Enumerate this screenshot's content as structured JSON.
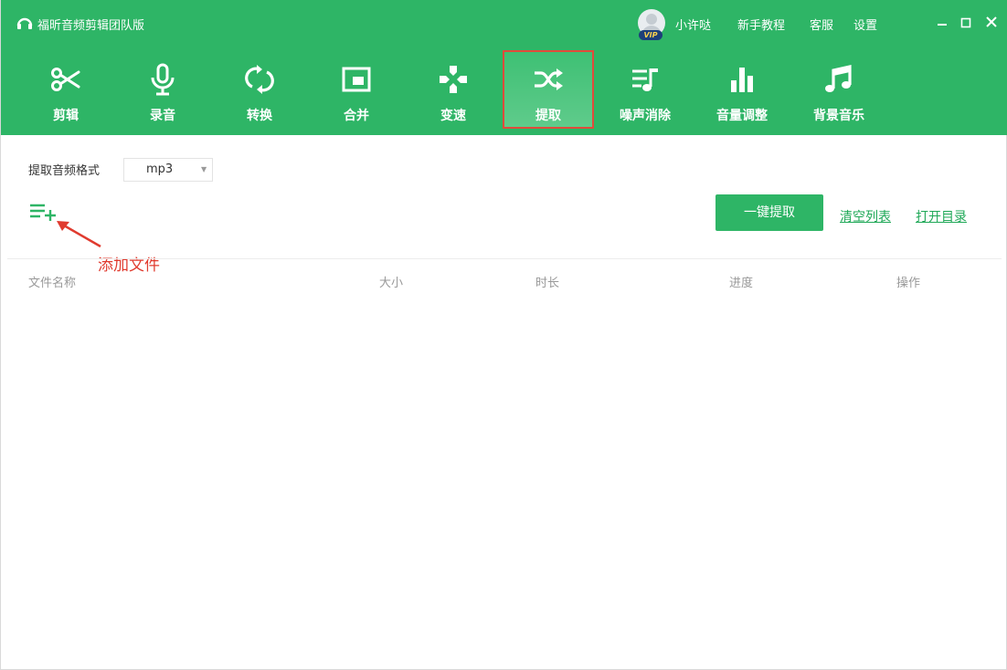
{
  "window": {
    "title": "福昕音频剪辑团队版",
    "user_name": "小许哒",
    "vip_badge": "VIP",
    "links": [
      "新手教程",
      "客服",
      "设置"
    ],
    "controls": {
      "minimize": "–",
      "maximize": "□",
      "close": "✕"
    }
  },
  "toolbar": {
    "active_index": 5,
    "items": [
      {
        "label": "剪辑",
        "icon": "scissors-icon"
      },
      {
        "label": "录音",
        "icon": "microphone-icon"
      },
      {
        "label": "转换",
        "icon": "convert-arrows-icon"
      },
      {
        "label": "合并",
        "icon": "merge-window-icon"
      },
      {
        "label": "变速",
        "icon": "speed-dpad-icon"
      },
      {
        "label": "提取",
        "icon": "shuffle-icon"
      },
      {
        "label": "噪声消除",
        "icon": "noise-removal-icon"
      },
      {
        "label": "音量调整",
        "icon": "volume-bars-icon"
      },
      {
        "label": "背景音乐",
        "icon": "music-note-icon"
      }
    ]
  },
  "settings": {
    "format_label": "提取音频格式",
    "format_value": "mp3"
  },
  "actions": {
    "add_file_icon": "playlist-add-icon",
    "add_file_annotation": "添加文件",
    "extract_label": "一键提取",
    "clear_list_label": "清空列表",
    "open_folder_label": "打开目录"
  },
  "table": {
    "columns": [
      "文件名称",
      "大小",
      "时长",
      "进度",
      "操作"
    ]
  },
  "colors": {
    "brand_green": "#2eb566",
    "highlight_red": "#e14b3b",
    "annotation_red": "#e03b2f",
    "link_green": "#1fa857"
  }
}
